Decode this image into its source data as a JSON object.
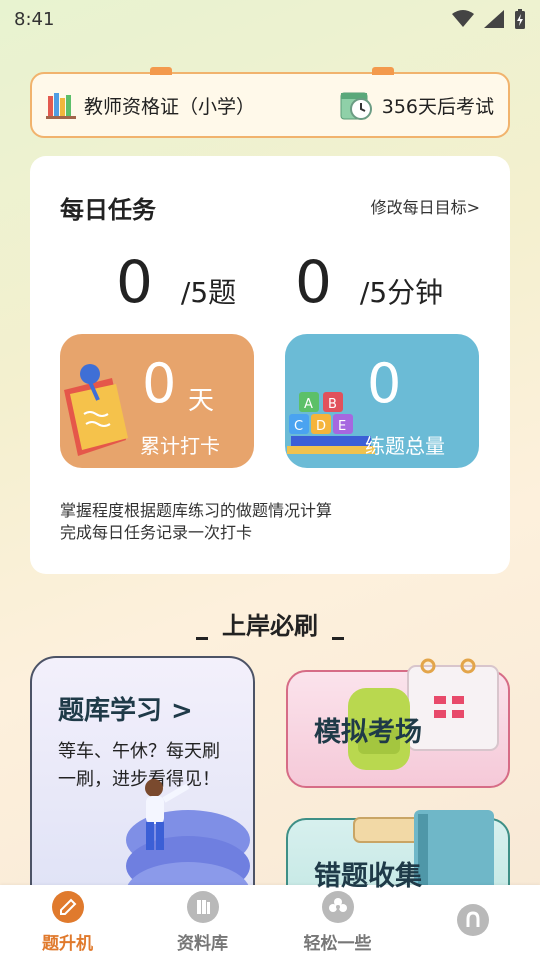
{
  "status_bar": {
    "time": "8:41"
  },
  "exam_banner": {
    "subject": "教师资格证（小学）",
    "countdown": "356天后考试"
  },
  "daily_task": {
    "title": "每日任务",
    "edit_link": "修改每日目标>",
    "questions_done": "0",
    "questions_goal": "/5题",
    "minutes_done": "0",
    "minutes_goal": "/5分钟",
    "checkin_days": "0",
    "checkin_unit": "天",
    "checkin_label": "累计打卡",
    "practice_total": "0",
    "practice_label": "练题总量",
    "note_line1": "掌握程度根据题库练习的做题情况计算",
    "note_line2": "完成每日任务记录一次打卡"
  },
  "section": {
    "title": "上岸必刷"
  },
  "cards": {
    "study_title": "题库学习 >",
    "study_desc": "等车、午休？每天刷一刷，进步看得见！",
    "mock_title": "模拟考场",
    "wrong_title": "错题收集"
  },
  "bottom_nav": {
    "items": [
      {
        "label": "题升机",
        "icon": "pencil-icon",
        "active": true
      },
      {
        "label": "资料库",
        "icon": "book-icon",
        "active": false
      },
      {
        "label": "轻松一些",
        "icon": "clover-icon",
        "active": false
      },
      {
        "label": "",
        "icon": "profile-icon",
        "active": false
      }
    ]
  },
  "colors": {
    "accent": "#e07a2d",
    "tile_orange": "#e7a46c",
    "tile_blue": "#6bbbd6"
  }
}
